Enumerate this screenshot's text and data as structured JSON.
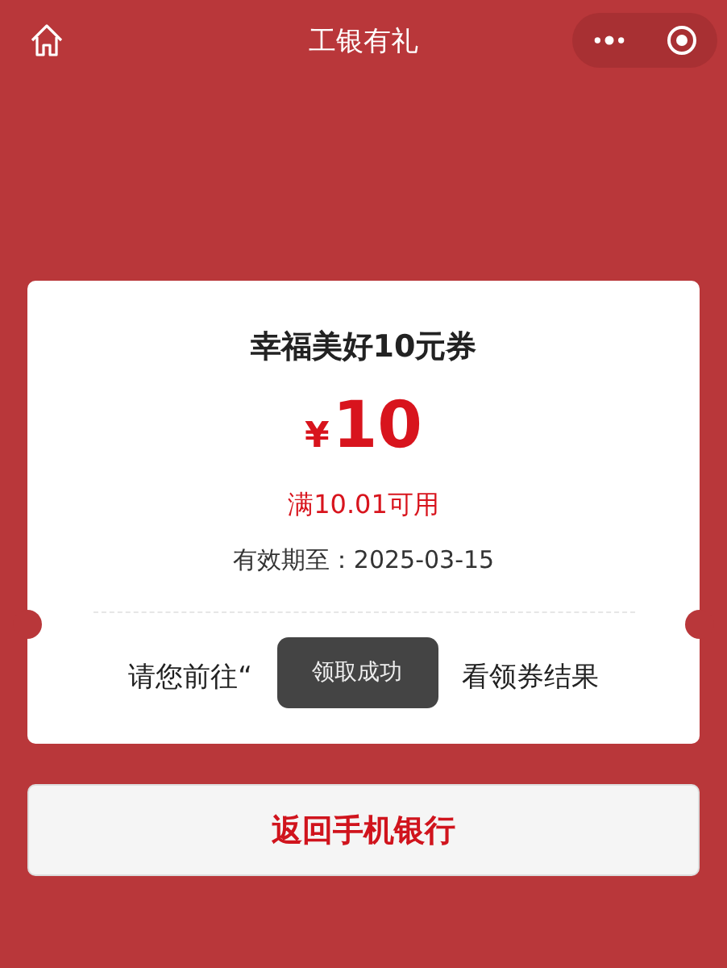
{
  "header": {
    "title": "工银有礼"
  },
  "coupon": {
    "name": "幸福美好10元券",
    "currency": "¥",
    "amount": "10",
    "condition": "满10.01可用",
    "validity": "有效期至：2025-03-15",
    "instruction_before": "请您前往“",
    "instruction_after": "看领券结果"
  },
  "toast": {
    "text": "领取成功"
  },
  "buttons": [
    {
      "label": "返回手机银行"
    }
  ]
}
